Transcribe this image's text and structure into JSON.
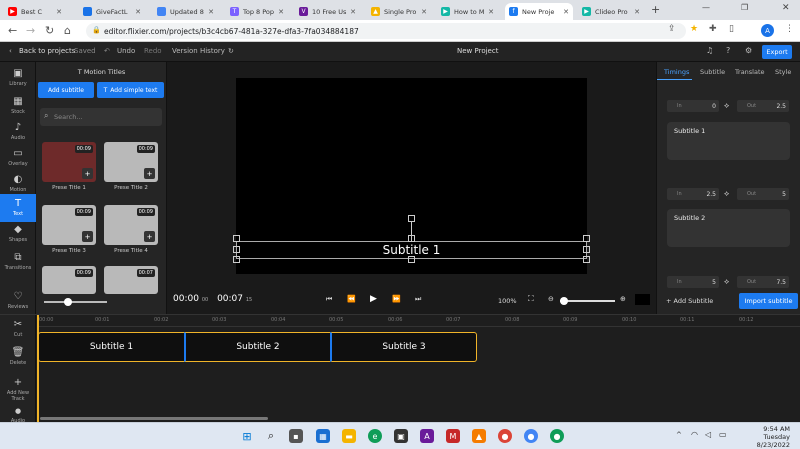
{
  "browser": {
    "tabs": [
      {
        "label": "Best C",
        "color": "#ff0000"
      },
      {
        "label": "GiveFactL",
        "color": "#1a73e8"
      },
      {
        "label": "Updated 8",
        "color": "#4285f4"
      },
      {
        "label": "Top 8 Pop",
        "color": "#7b61ff"
      },
      {
        "label": "10 Free Us",
        "color": "#6a1b9a"
      },
      {
        "label": "Single Pro",
        "color": "#f4b400"
      },
      {
        "label": "How to M",
        "color": "#14b8a6"
      },
      {
        "label": "New Proje",
        "color": "#1d7bf0"
      },
      {
        "label": "Clideo Pro",
        "color": "#14b8a6"
      }
    ],
    "url": "editor.flixier.com/projects/b3c4cb67-481a-327e-dfa3-7fa034884187"
  },
  "header": {
    "back": "Back to projects",
    "saved": "Saved",
    "undo": "Undo",
    "redo": "Redo",
    "history": "Version History",
    "project": "New Project",
    "export": "Export"
  },
  "rail": [
    "Library",
    "Stock",
    "Audio",
    "Overlay",
    "Motion",
    "Text",
    "Shapes",
    "Transitions",
    "Reviews"
  ],
  "panel": {
    "title": "Motion Titles",
    "add_subtitle": "Add subtitle",
    "add_simple": "Add simple text",
    "search_placeholder": "Search...",
    "items": [
      {
        "name": "Prese Title 1",
        "dur": "00:09"
      },
      {
        "name": "Prese Title 2",
        "dur": "00:09"
      },
      {
        "name": "Prese Title 3",
        "dur": "00:09"
      },
      {
        "name": "Prese Title 4",
        "dur": "00:09"
      },
      {
        "name": "",
        "dur": "00:09"
      },
      {
        "name": "",
        "dur": "00:07"
      }
    ]
  },
  "canvas": {
    "subtitle": "Subtitle 1",
    "time_current": "00:00",
    "time_current_frame": "00",
    "time_total": "00:07",
    "time_total_frame": "15",
    "zoom": "100%"
  },
  "right": {
    "tabs": [
      "Timings",
      "Subtitle",
      "Translate",
      "Style"
    ],
    "subtitles": [
      {
        "in": "0",
        "out": "2.5",
        "text": "Subtitle 1"
      },
      {
        "in": "2.5",
        "out": "5",
        "text": "Subtitle 2"
      },
      {
        "in": "5",
        "out": "7.5",
        "text": ""
      }
    ],
    "in_label": "In",
    "out_label": "Out",
    "add": "+ Add Subtitle",
    "import": "Import subtitle"
  },
  "timeline": {
    "ticks": [
      "00:00",
      "00:01",
      "00:02",
      "00:03",
      "00:04",
      "00:05",
      "00:06",
      "00:07",
      "00:08",
      "00:09",
      "00:10",
      "00:11",
      "00:12"
    ],
    "tools": [
      "Cut",
      "Delete",
      "Add New Track",
      "Audio"
    ],
    "clips": [
      "Subtitle 1",
      "Subtitle 2",
      "Subtitle 3"
    ]
  },
  "taskbar": {
    "time": "9:54 AM",
    "day": "Tuesday",
    "date": "8/23/2022"
  }
}
